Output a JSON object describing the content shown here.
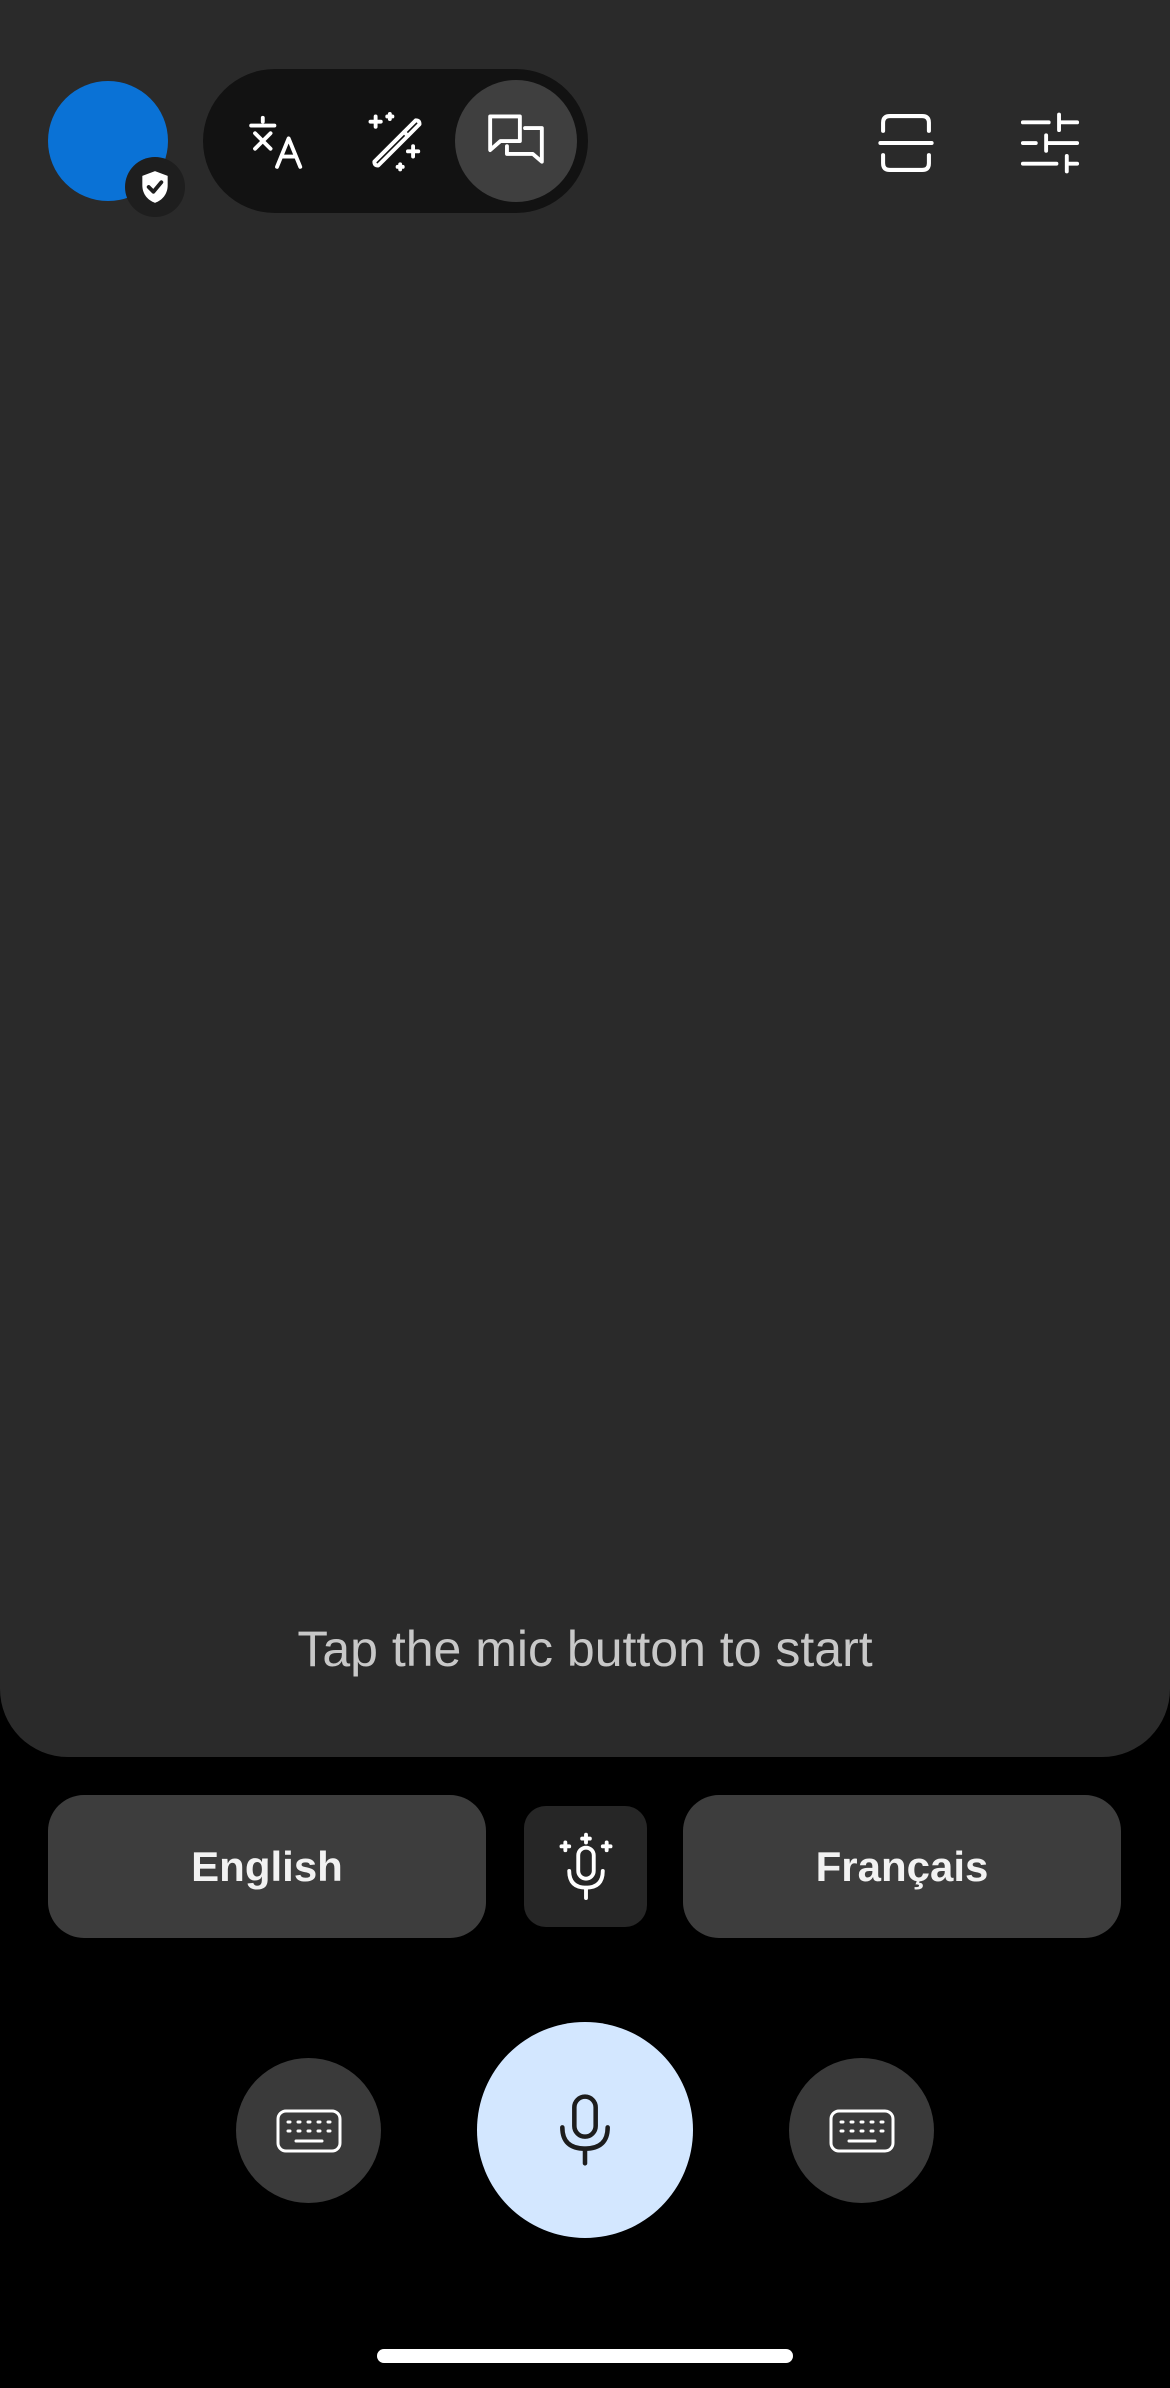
{
  "header": {
    "avatar_color": "#0a72d6",
    "avatar_badge_icon": "shield-check-icon",
    "modes": [
      {
        "name": "translate",
        "icon": "translate-icon",
        "active": false
      },
      {
        "name": "write",
        "icon": "magic-pen-icon",
        "active": false
      },
      {
        "name": "conversation",
        "icon": "conversation-icon",
        "active": true
      }
    ],
    "right_icons": [
      "scan-icon",
      "settings-sliders-icon"
    ]
  },
  "main": {
    "hint": "Tap the mic button to start"
  },
  "languages": {
    "left": "English",
    "right": "Français",
    "center_icon": "auto-mic-icon"
  },
  "controls": {
    "left_icon": "keyboard-icon",
    "center_icon": "mic-icon",
    "right_icon": "keyboard-icon",
    "mic_color": "#d3e7ff"
  }
}
